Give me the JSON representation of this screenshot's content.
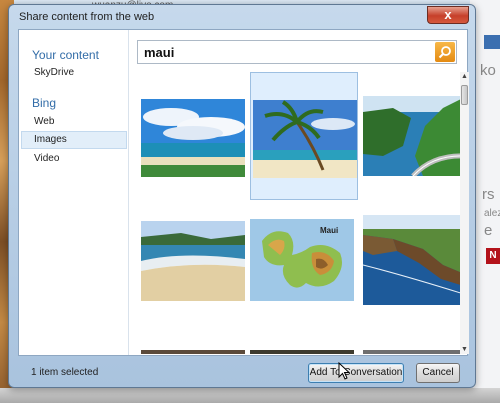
{
  "background": {
    "top_text": "wuanzu@live.com",
    "right_texts": [
      "ko",
      "rs",
      "alez",
      "e"
    ]
  },
  "dialog": {
    "title": "Share content from the web",
    "close_label": "x"
  },
  "sidebar": {
    "sections": [
      {
        "heading": "Your content",
        "items": [
          {
            "label": "SkyDrive",
            "selected": false
          }
        ]
      },
      {
        "heading": "Bing",
        "items": [
          {
            "label": "Web",
            "selected": false
          },
          {
            "label": "Images",
            "selected": true
          },
          {
            "label": "Video",
            "selected": false
          }
        ]
      }
    ]
  },
  "search": {
    "query": "maui",
    "button_icon": "search-icon"
  },
  "results": {
    "images": [
      {
        "subject": "beach-clouds",
        "selected": false
      },
      {
        "subject": "palm-tree-beach",
        "selected": true
      },
      {
        "subject": "coastal-road-cliffs",
        "selected": false
      },
      {
        "subject": "sandy-beach-surf",
        "selected": false
      },
      {
        "subject": "maui-map",
        "map_label": "Maui",
        "selected": false
      },
      {
        "subject": "sea-cliffs",
        "selected": false
      }
    ]
  },
  "footer": {
    "status": "1 item selected",
    "add_button": "Add To Conversation",
    "cancel_button": "Cancel"
  },
  "colors": {
    "accent": "#336da8",
    "search_button": "#e48a12",
    "selection": "#dfeefd"
  }
}
